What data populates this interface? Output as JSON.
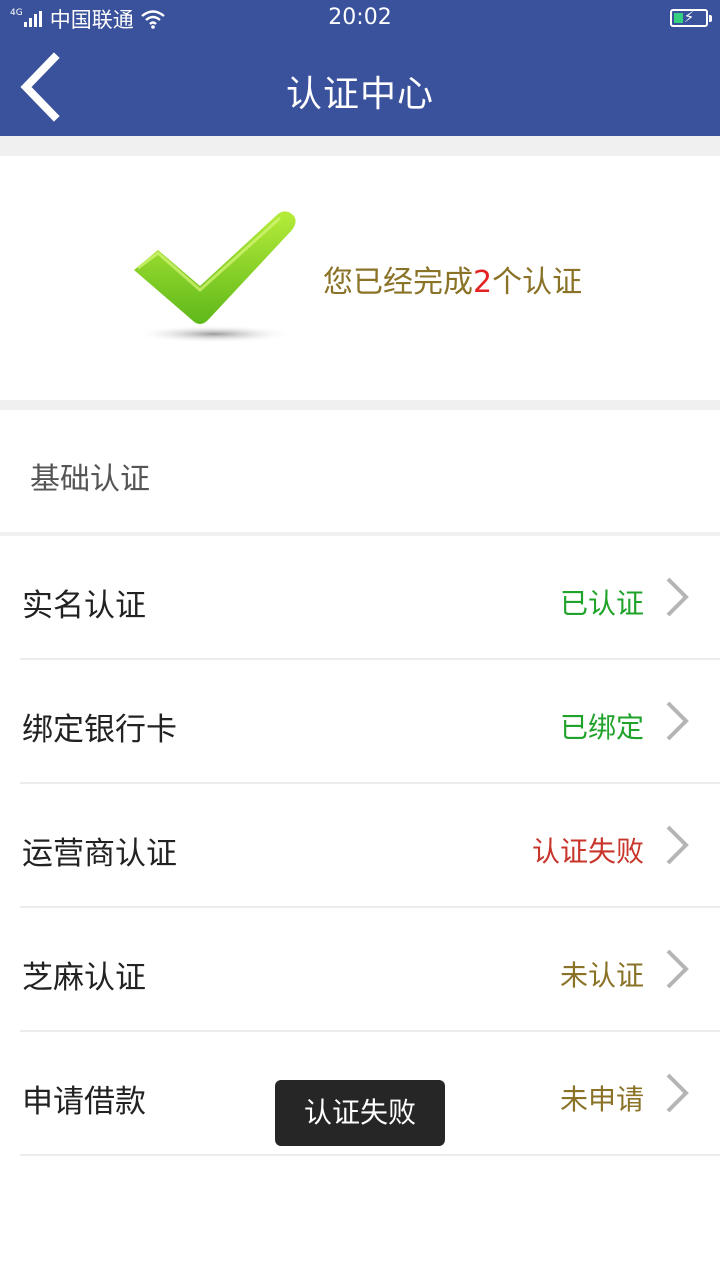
{
  "status_bar": {
    "network": "4G",
    "carrier": "中国联通",
    "time": "20:02"
  },
  "header": {
    "title": "认证中心"
  },
  "banner": {
    "text_before": "您已经完成",
    "count": "2",
    "text_after": "个认证"
  },
  "section": {
    "title": "基础认证"
  },
  "items": [
    {
      "label": "实名认证",
      "status": "已认证",
      "status_color": "#1fa32a"
    },
    {
      "label": "绑定银行卡",
      "status": "已绑定",
      "status_color": "#1fa32a"
    },
    {
      "label": "运营商认证",
      "status": "认证失败",
      "status_color": "#c8352b"
    },
    {
      "label": "芝麻认证",
      "status": "未认证",
      "status_color": "#8a7227"
    },
    {
      "label": "申请借款",
      "status": "未申请",
      "status_color": "#8a7227"
    }
  ],
  "toast": {
    "text": "认证失败"
  },
  "colors": {
    "header_bg": "#3a519b",
    "banner_text": "#8a7227",
    "count_highlight": "#e32222"
  }
}
